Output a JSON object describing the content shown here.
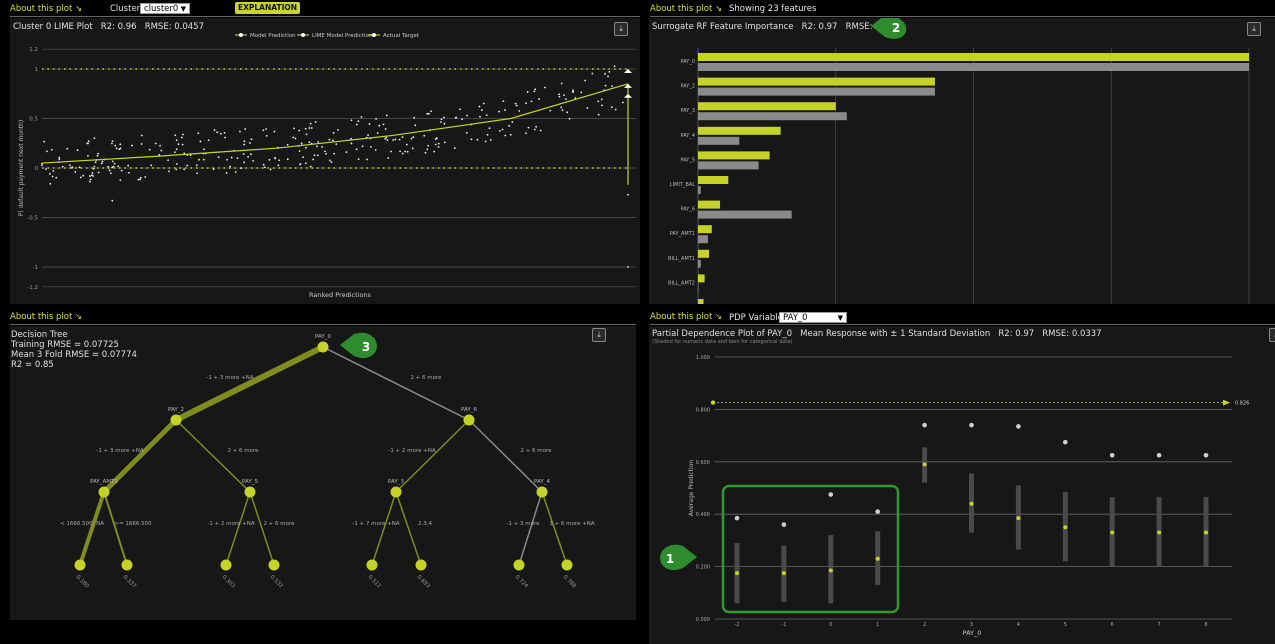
{
  "lime": {
    "about": "About this plot ↘",
    "cluster_label": "Cluster:",
    "cluster_value": "cluster0",
    "explanation": "EXPLANATION",
    "title": "Cluster 0 LIME Plot",
    "r2": "R2: 0.96",
    "rmse": "RMSE: 0.0457",
    "legend": [
      "Model Prediction",
      "LIME Model Prediction",
      "Actual Target"
    ],
    "ylabel": "P( default payment next month)",
    "xlabel": "Ranked Predictions",
    "yticks": [
      "1.2",
      "1",
      "0.5",
      "0",
      "-0.5",
      "-1",
      "-1.2"
    ]
  },
  "rf": {
    "about": "About this plot ↘",
    "showing": "Showing 23 features",
    "title": "Surrogate RF Feature Importance",
    "r2": "R2: 0.97",
    "rmse": "RMSE: 0.0337",
    "badge": "2"
  },
  "tree": {
    "about": "About this plot ↘",
    "title": "Decision Tree",
    "train_rmse": "Training RMSE = 0.07725",
    "cv_rmse": "Mean 3 Fold RMSE = 0.07774",
    "r2": "R2 = 0.85",
    "badge": "3",
    "nodes": {
      "root": "PAY_0",
      "l1": "PAY_2",
      "r1": "PAY_6",
      "l2a": "PAY_AMT1",
      "l2b": "PAY_5",
      "r2a": "PAY_3",
      "r2b": "PAY_4"
    },
    "edges": {
      "root_l": "-1 + 3 more +NA",
      "root_r": "2 + 6 more",
      "l1_l": "-1 + 3 more +NA",
      "l1_r": "2 + 6 more",
      "r1_l": "-1 + 2 more +NA",
      "r1_r": "2 + 6 more",
      "l2a_l": "< 1666.500, NA",
      "l2a_r": ">= 1666.500",
      "l2b_l": "-1 + 2 more +NA",
      "l2b_r": "2 + 6 more",
      "r2a_l": "-1 + 7 more +NA",
      "r2a_r": "2,3,4",
      "r2b_l": "-1 + 3 more",
      "r2b_r": "1 + 6 more +NA"
    },
    "leaves": [
      "0.180",
      "0.337",
      "0.303",
      "0.532",
      "0.512",
      "0.693",
      "0.724",
      "0.788"
    ]
  },
  "pdp": {
    "about": "About this plot ↘",
    "var_label": "PDP Variable:",
    "var_value": "PAY_0",
    "title": "Partial Dependence Plot of PAY_0",
    "subtitle": "Mean Response with ± 1 Standard Deviation",
    "r2": "R2: 0.97",
    "rmse": "RMSE: 0.0337",
    "note": "(Shaded for numeric data and bars for categorical data)",
    "ylabel": "Average Prediction",
    "xlabel": "PAY_0",
    "ref_label": "0.826",
    "badge": "1"
  },
  "chart_data": [
    {
      "type": "scatter",
      "title": "Cluster 0 LIME Plot",
      "xlabel": "Ranked Predictions",
      "ylabel": "P( default payment next month)",
      "ylim": [
        -1.2,
        1.2
      ],
      "series": [
        {
          "name": "Model Prediction",
          "trend": [
            [
              0,
              0.05
            ],
            [
              20,
              0.12
            ],
            [
              40,
              0.2
            ],
            [
              60,
              0.33
            ],
            [
              80,
              0.5
            ],
            [
              100,
              0.85
            ]
          ]
        },
        {
          "name": "LIME Model Prediction"
        },
        {
          "name": "Actual Target",
          "values": [
            0,
            1
          ]
        }
      ]
    },
    {
      "type": "bar",
      "title": "Surrogate RF Feature Importance",
      "categories": [
        "PAY_0",
        "PAY_2",
        "PAY_3",
        "PAY_4",
        "PAY_5",
        "LIMIT_BAL",
        "PAY_6",
        "PAY_AMT1",
        "BILL_AMT1",
        "BILL_AMT2"
      ],
      "series": [
        {
          "values": [
            1.0,
            0.43,
            0.25,
            0.15,
            0.13,
            0.055,
            0.04,
            0.025,
            0.02,
            0.012
          ],
          "color": "#c5d329"
        },
        {
          "values": [
            1.0,
            0.43,
            0.27,
            0.075,
            0.11,
            0.005,
            0.17,
            0.018,
            0.005,
            0.0
          ],
          "color": "#8a8a8a"
        }
      ],
      "partial_next": 0.01
    },
    {
      "type": "bar",
      "title": "Partial Dependence Plot of PAY_0",
      "xlabel": "PAY_0",
      "ylabel": "Average Prediction",
      "ylim": [
        0,
        1.0
      ],
      "yticks": [
        "0.000",
        "0.200",
        "0.400",
        "0.600",
        "0.800",
        "1.000"
      ],
      "categories": [
        "-2",
        "-1",
        "0",
        "1",
        "2",
        "3",
        "4",
        "5",
        "6",
        "7",
        "8"
      ],
      "mean": [
        0.175,
        0.175,
        0.185,
        0.23,
        0.59,
        0.44,
        0.385,
        0.35,
        0.33,
        0.33,
        0.33
      ],
      "sd_low": [
        0.06,
        0.065,
        0.06,
        0.13,
        0.52,
        0.33,
        0.265,
        0.22,
        0.2,
        0.2,
        0.2
      ],
      "sd_high": [
        0.29,
        0.28,
        0.32,
        0.335,
        0.655,
        0.555,
        0.51,
        0.485,
        0.465,
        0.465,
        0.465
      ],
      "target": [
        0.385,
        0.36,
        0.475,
        0.41,
        0.74,
        0.74,
        0.735,
        0.675,
        0.625,
        0.625,
        0.625
      ],
      "reference": 0.826
    }
  ]
}
